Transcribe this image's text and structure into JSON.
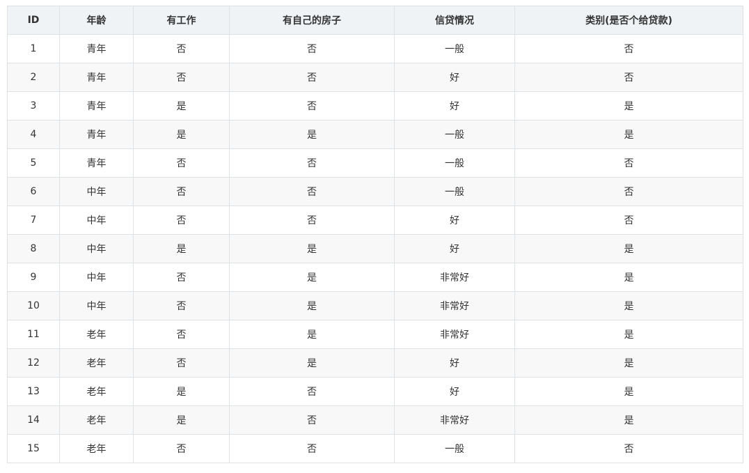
{
  "table": {
    "columns": [
      "ID",
      "年龄",
      "有工作",
      "有自己的房子",
      "信贷情况",
      "类别(是否个给贷款)"
    ],
    "rows": [
      [
        "1",
        "青年",
        "否",
        "否",
        "一般",
        "否"
      ],
      [
        "2",
        "青年",
        "否",
        "否",
        "好",
        "否"
      ],
      [
        "3",
        "青年",
        "是",
        "否",
        "好",
        "是"
      ],
      [
        "4",
        "青年",
        "是",
        "是",
        "一般",
        "是"
      ],
      [
        "5",
        "青年",
        "否",
        "否",
        "一般",
        "否"
      ],
      [
        "6",
        "中年",
        "否",
        "否",
        "一般",
        "否"
      ],
      [
        "7",
        "中年",
        "否",
        "否",
        "好",
        "否"
      ],
      [
        "8",
        "中年",
        "是",
        "是",
        "好",
        "是"
      ],
      [
        "9",
        "中年",
        "否",
        "是",
        "非常好",
        "是"
      ],
      [
        "10",
        "中年",
        "否",
        "是",
        "非常好",
        "是"
      ],
      [
        "11",
        "老年",
        "否",
        "是",
        "非常好",
        "是"
      ],
      [
        "12",
        "老年",
        "否",
        "是",
        "好",
        "是"
      ],
      [
        "13",
        "老年",
        "是",
        "否",
        "好",
        "是"
      ],
      [
        "14",
        "老年",
        "是",
        "否",
        "非常好",
        "是"
      ],
      [
        "15",
        "老年",
        "否",
        "否",
        "一般",
        "否"
      ]
    ]
  }
}
